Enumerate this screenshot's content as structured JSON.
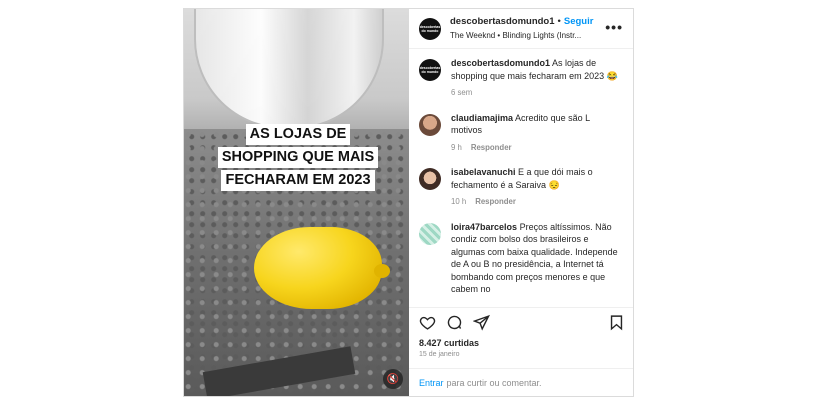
{
  "post": {
    "overlay_lines": [
      "AS LOJAS DE",
      "SHOPPING QUE MAIS",
      "FECHARAM EM 2023"
    ],
    "mute_icon": "speaker-muted-icon"
  },
  "header": {
    "username": "descobertasdomundo1",
    "separator": "•",
    "follow_label": "Seguir",
    "audio": "The Weeknd • Blinding Lights (Instr...",
    "avatar_text": "descobertas do mundo"
  },
  "comments": [
    {
      "user": "descobertasdomundo1",
      "text": "As lojas de shopping que mais fecharam em 2023 😂",
      "time": "6 sem",
      "reply": ""
    },
    {
      "user": "claudiamajima",
      "text": "Acredito que são L motivos",
      "time": "9 h",
      "reply": "Responder"
    },
    {
      "user": "isabelavanuchi",
      "text": "E a que dói mais o fechamento é a Saraiva 😔",
      "time": "10 h",
      "reply": "Responder"
    },
    {
      "user": "loira47barcelos",
      "text": "Preços altíssimos. Não condiz com bolso dos brasileiros e algumas com baixa qualidade. Independe de A ou B no presidência, a Internet tá bombando com preços menores e que cabem no",
      "time": "",
      "reply": ""
    }
  ],
  "actions": {
    "likes": "8.427 curtidas",
    "date": "15 de janeiro",
    "enter_label": "Entrar",
    "enter_suffix": "para curtir ou comentar."
  },
  "colors": {
    "link": "#0095f6",
    "muted": "#8e8e8e",
    "text": "#262626"
  }
}
